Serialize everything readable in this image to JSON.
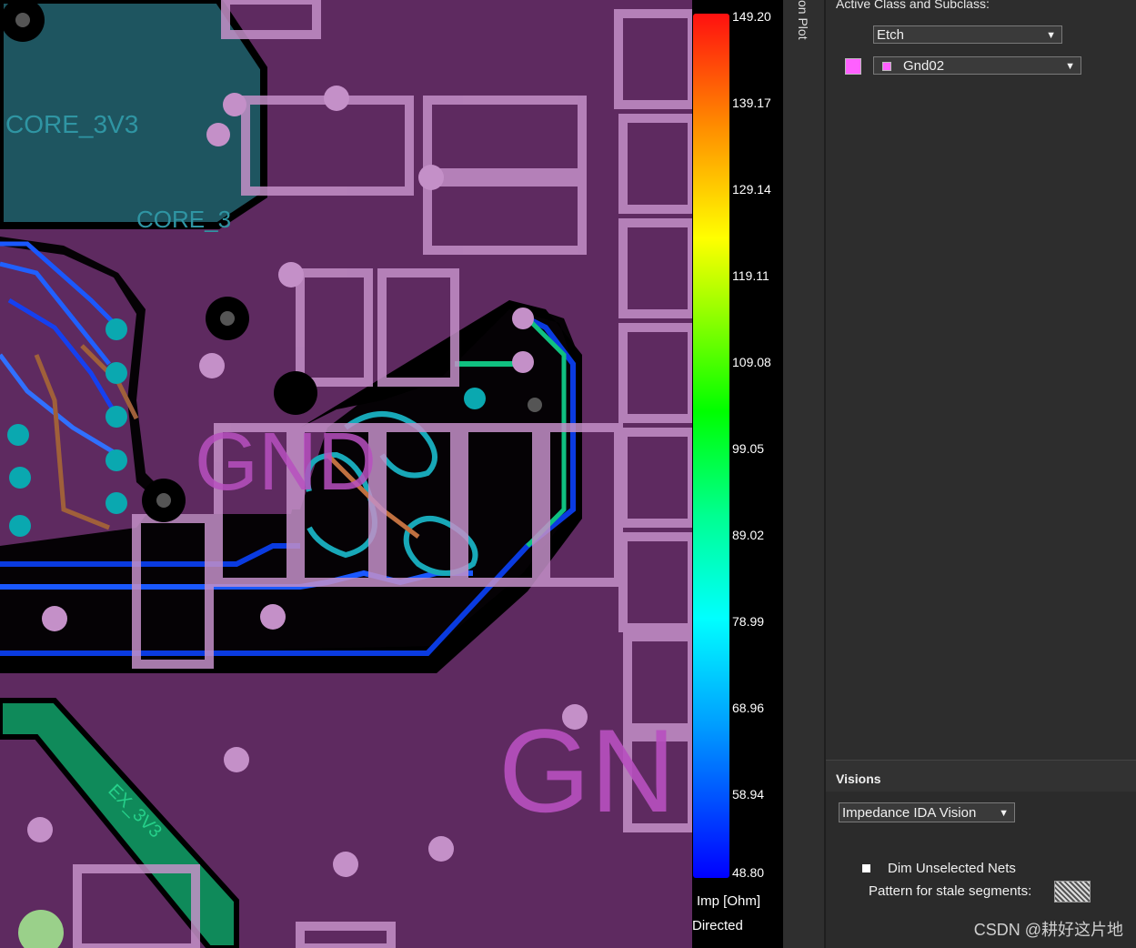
{
  "canvas": {
    "labels": {
      "core_a": "CORE_3V3",
      "core_b": "CORE_3",
      "gnd_small": "GND",
      "gnd_big": "GN",
      "ex": "EX_3V3"
    },
    "colors": {
      "board": "#5e2a60",
      "copper_pad": "#c490c8",
      "core_plane": "#1e5560",
      "ex_plane": "#0f8a5a"
    }
  },
  "legend": {
    "ticks": [
      "149.20",
      "139.17",
      "129.14",
      "119.11",
      "109.08",
      "99.05",
      "89.02",
      "78.99",
      "68.96",
      "58.94",
      "48.80"
    ],
    "unit": "Imp [Ohm]",
    "mode": "Directed"
  },
  "side_title": "on Plot",
  "panel": {
    "heading": "Active Class and Subclass:",
    "class_value": "Etch",
    "subclass_value": "Gnd02",
    "subclass_color": "#ff60ff"
  },
  "visions": {
    "title": "Visions",
    "vision_value": "Impedance IDA Vision",
    "dim_label": "Dim Unselected Nets",
    "pattern_label": "Pattern for stale segments:"
  },
  "watermark": "CSDN @耕好这片地"
}
